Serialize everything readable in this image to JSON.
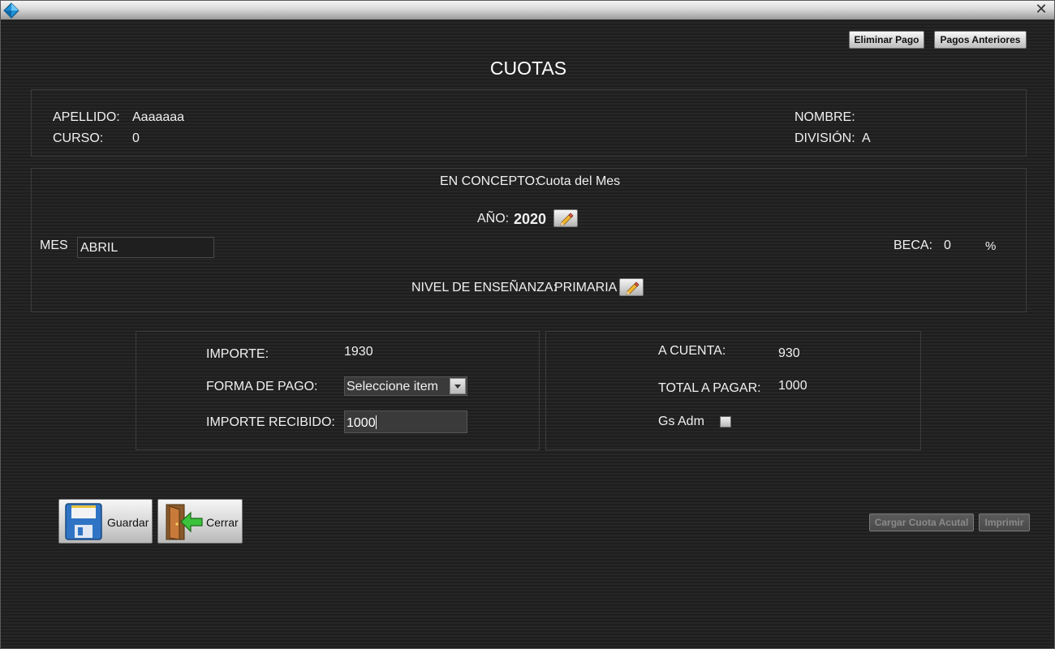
{
  "window": {
    "close_glyph": "✕",
    "icon": "app-diamond-icon"
  },
  "toolbar": {
    "eliminar_pago": "Eliminar Pago",
    "pagos_anteriores": "Pagos Anteriores"
  },
  "title": "CUOTAS",
  "student": {
    "apellido_label": "APELLIDO:",
    "apellido_value": "Aaaaaaa",
    "curso_label": "CURSO:",
    "curso_value": "0",
    "nombre_label": "NOMBRE:",
    "nombre_value": "",
    "division_label": "DIVISIÓN:",
    "division_value": "A"
  },
  "concept": {
    "concepto_label": "EN CONCEPTO:",
    "concepto_value": "Cuota del Mes",
    "anio_label": "AÑO:",
    "anio_value": "2020",
    "mes_label": "MES",
    "mes_value": "ABRIL",
    "beca_label": "BECA:",
    "beca_value": "0",
    "beca_unit": "%",
    "nivel_label": "NIVEL DE ENSEÑANZA:",
    "nivel_value": "PRIMARIA"
  },
  "payment": {
    "importe_label": "IMPORTE:",
    "importe_value": "1930",
    "forma_label": "FORMA DE PAGO:",
    "forma_value": "Seleccione item",
    "recibido_label": "IMPORTE RECIBIDO:",
    "recibido_value": "1000",
    "a_cuenta_label": "A CUENTA:",
    "a_cuenta_value": "930",
    "total_label": "TOTAL A PAGAR:",
    "total_value": "1000",
    "gs_adm_label": "Gs Adm",
    "gs_adm_checked": false
  },
  "actions": {
    "guardar": "Guardar",
    "cerrar": "Cerrar",
    "cargar_cuota": "Cargar Cuota Acutal",
    "imprimir": "Imprimir"
  },
  "colors": {
    "background": "#1e1e1e",
    "text": "#f0f0f0",
    "disabled_text": "#8a8a8a"
  }
}
